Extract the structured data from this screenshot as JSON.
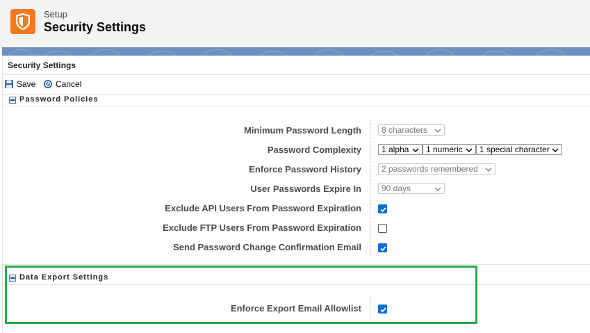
{
  "header": {
    "icon": "shield-icon",
    "setup_label": "Setup",
    "title": "Security Settings",
    "icon_color": "#f4791f"
  },
  "panel": {
    "title": "Security Settings"
  },
  "toolbar": {
    "save_label": "Save",
    "cancel_label": "Cancel",
    "save_icon": "floppy-disk-icon",
    "cancel_icon": "cancel-circle-icon"
  },
  "password_policies": {
    "heading": "Password Policies",
    "fields": {
      "min_length": {
        "label": "Minimum Password Length",
        "value": "8 characters"
      },
      "complexity": {
        "label": "Password Complexity",
        "alpha": "1 alpha",
        "numeric": "1 numeric",
        "special": "1 special character"
      },
      "history": {
        "label": "Enforce Password History",
        "value": "2 passwords remembered"
      },
      "expire": {
        "label": "User Passwords Expire In",
        "value": "90 days"
      },
      "exclude_api": {
        "label": "Exclude API Users From Password Expiration",
        "checked": true
      },
      "exclude_ftp": {
        "label": "Exclude FTP Users From Password Expiration",
        "checked": false
      },
      "send_email": {
        "label": "Send Password Change Confirmation Email",
        "checked": true
      }
    }
  },
  "data_export": {
    "heading": "Data Export Settings",
    "fields": {
      "allowlist": {
        "label": "Enforce Export Email Allowlist",
        "checked": true
      }
    }
  },
  "colors": {
    "checkbox_checked": "#0b6cd6",
    "highlight": "#2aa84a",
    "banner": "#6e8fc0"
  }
}
